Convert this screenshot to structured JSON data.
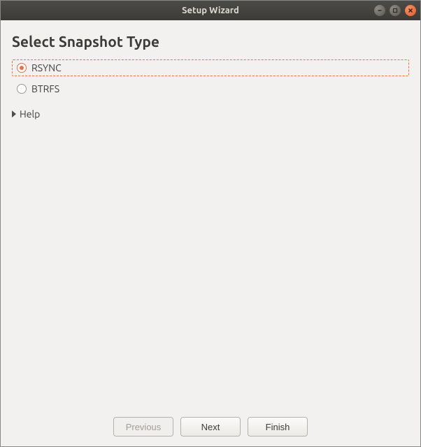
{
  "window": {
    "title": "Setup Wizard"
  },
  "page": {
    "heading": "Select Snapshot Type"
  },
  "options": {
    "rsync": {
      "label": "RSYNC",
      "selected": true
    },
    "btrfs": {
      "label": "BTRFS",
      "selected": false
    }
  },
  "help": {
    "label": "Help",
    "expanded": false
  },
  "buttons": {
    "previous": {
      "label": "Previous",
      "enabled": false
    },
    "next": {
      "label": "Next",
      "enabled": true
    },
    "finish": {
      "label": "Finish",
      "enabled": true
    }
  }
}
